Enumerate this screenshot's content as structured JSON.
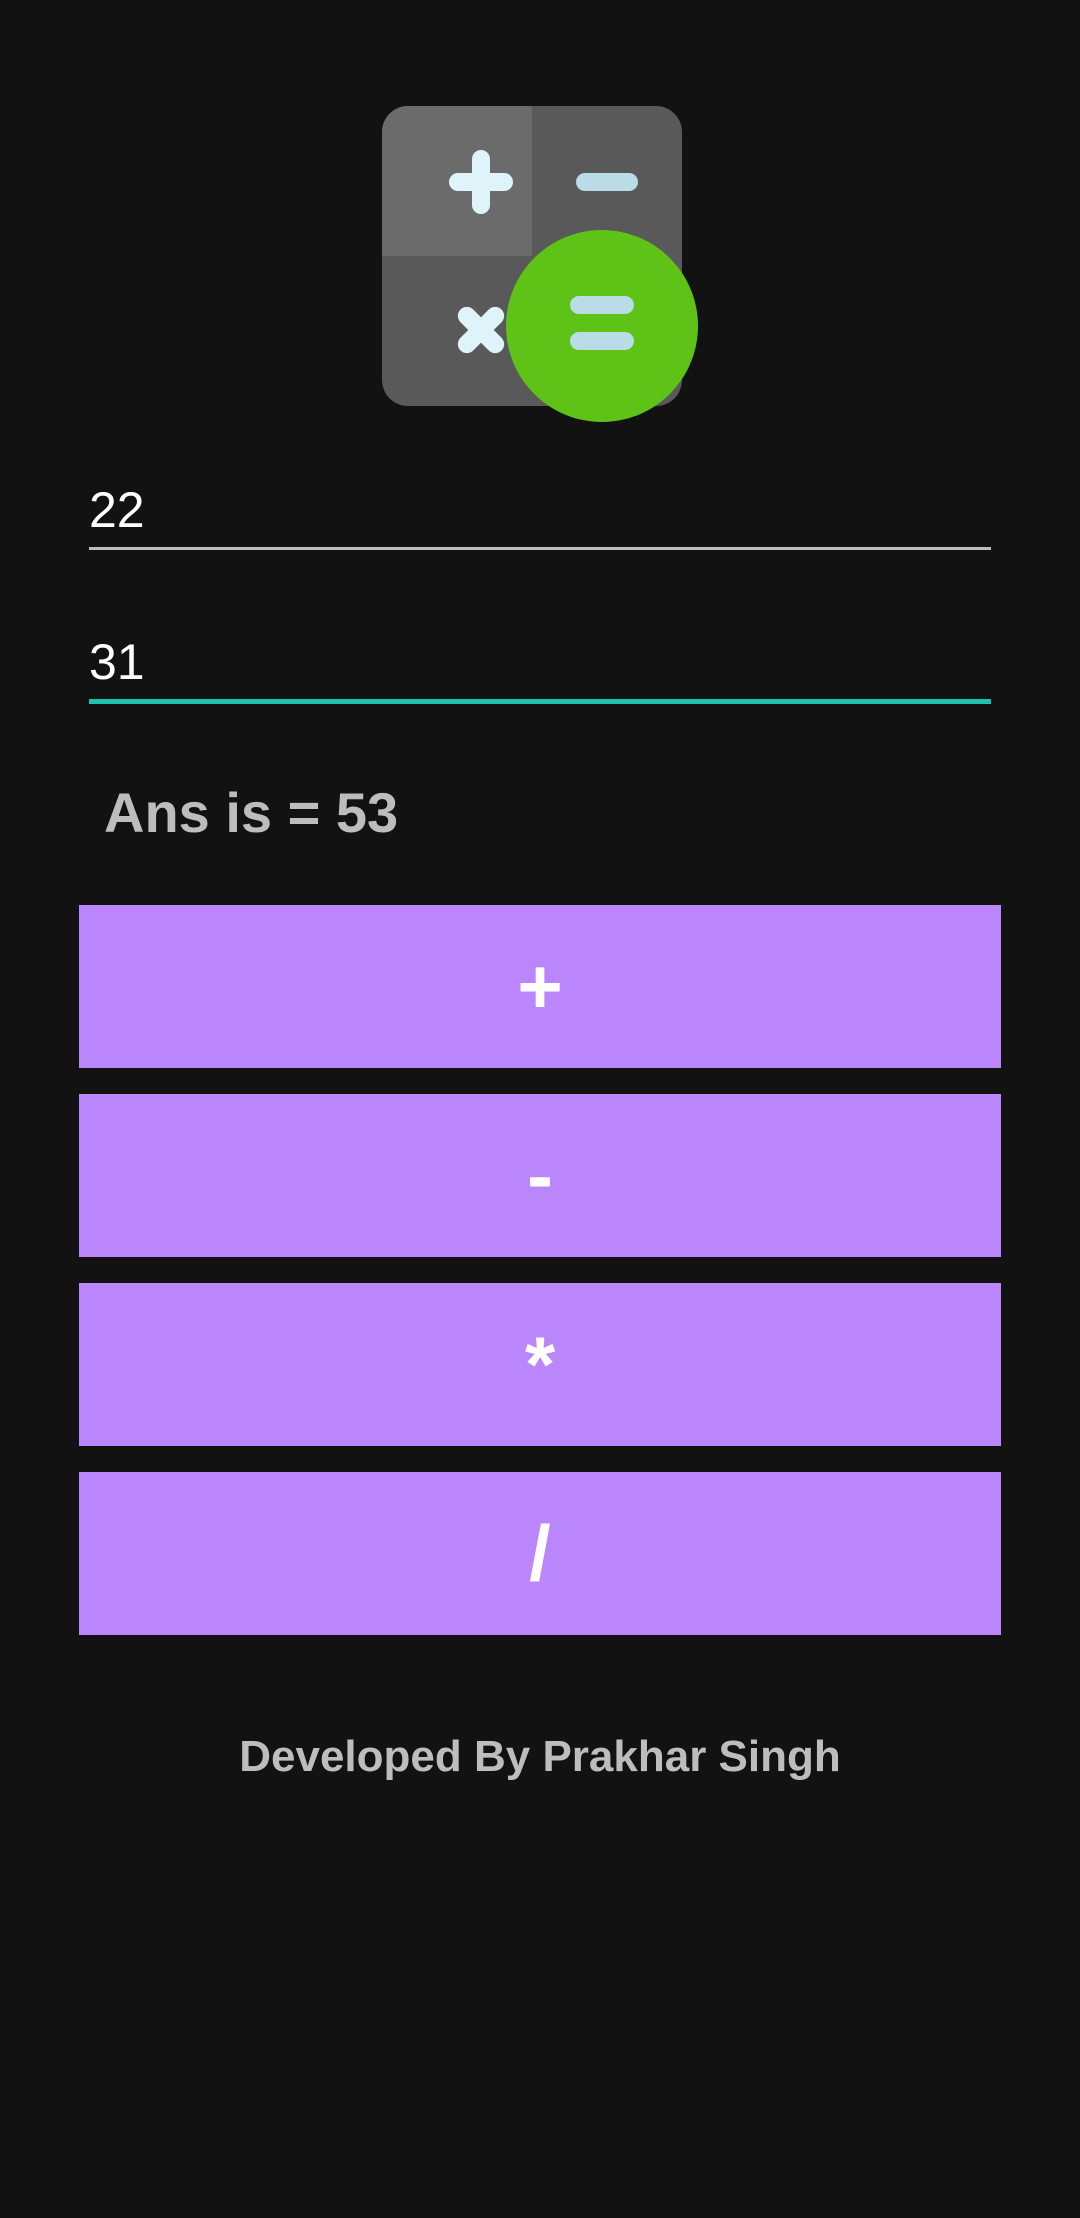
{
  "logo": {
    "icon": "calculator-icon"
  },
  "inputs": {
    "first_value": "22",
    "second_value": "31"
  },
  "result": {
    "text": "Ans is = 53"
  },
  "buttons": {
    "add": "+",
    "subtract": "-",
    "multiply": "*",
    "divide": "/"
  },
  "footer": {
    "credit": "Developed By Prakhar Singh"
  },
  "colors": {
    "background": "#121212",
    "button": "#bb86fc",
    "accent_underline": "#1fc2b0",
    "equals_circle": "#5ec217"
  }
}
